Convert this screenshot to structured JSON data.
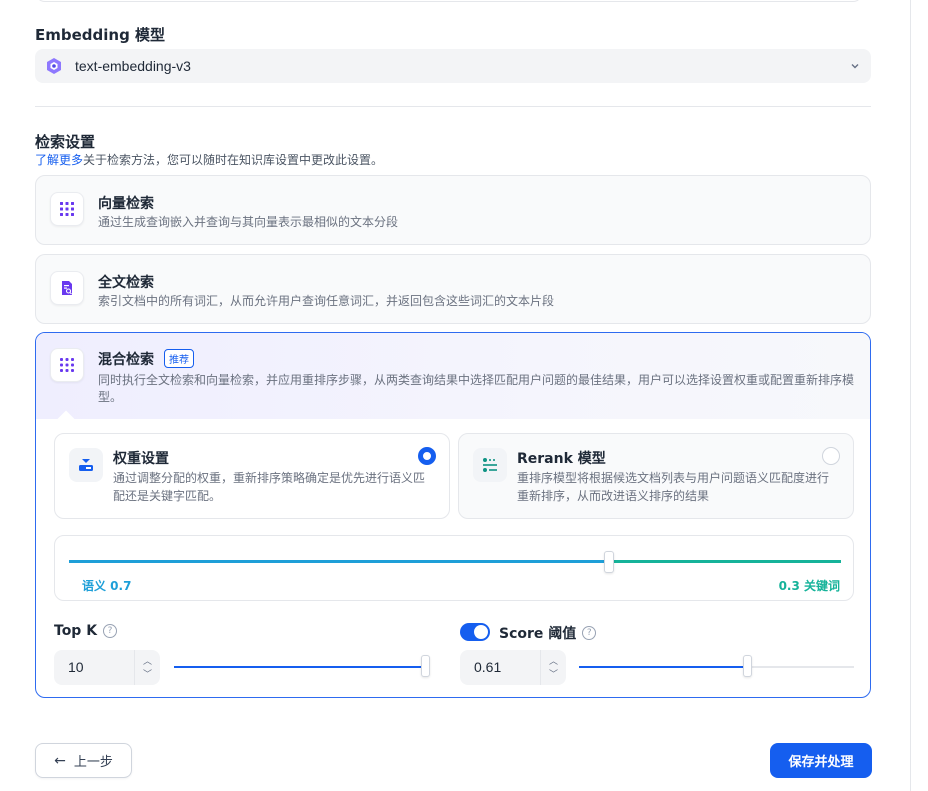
{
  "embedding": {
    "section_title": "Embedding 模型",
    "selected_model": "text-embedding-v3",
    "icon": "model-provider-logo-icon"
  },
  "retrieval": {
    "section_title": "检索设置",
    "learn_more": "了解更多",
    "subtitle_rest": "关于检索方法，您可以随时在知识库设置中更改此设置。",
    "methods": [
      {
        "title": "向量检索",
        "desc": "通过生成查询嵌入并查询与其向量表示最相似的文本分段",
        "icon": "vector-grid-icon"
      },
      {
        "title": "全文检索",
        "desc": "索引文档中的所有词汇，从而允许用户查询任意词汇，并返回包含这些词汇的文本片段",
        "icon": "document-search-icon"
      },
      {
        "title": "混合检索",
        "badge": "推荐",
        "desc": "同时执行全文检索和向量检索，并应用重排序步骤，从两类查询结果中选择匹配用户问题的最佳结果，用户可以选择设置权重或配置重新排序模型。",
        "icon": "hybrid-grid-icon"
      }
    ],
    "options": [
      {
        "title": "权重设置",
        "desc": "通过调整分配的权重，重新排序策略确定是优先进行语义匹配还是关键字匹配。",
        "selected": true
      },
      {
        "title": "Rerank 模型",
        "desc": "重排序模型将根据候选文档列表与用户问题语义匹配度进行重新排序，从而改进语义排序的结果",
        "selected": false
      }
    ],
    "weight": {
      "semantic_label": "语义 0.7",
      "keyword_label": "0.3 关键词",
      "semantic_value": 0.7,
      "keyword_value": 0.3
    },
    "top_k": {
      "label": "Top K",
      "value": "10",
      "slider_fraction": 1.0
    },
    "score": {
      "label": "Score 阈值",
      "value": "0.61",
      "enabled": true,
      "slider_fraction": 0.61
    }
  },
  "footer": {
    "prev_label": "上一步",
    "save_label": "保存并处理"
  },
  "colors": {
    "accent": "#155eef",
    "semantic": "#1e9fd8",
    "keyword": "#16b39a"
  }
}
